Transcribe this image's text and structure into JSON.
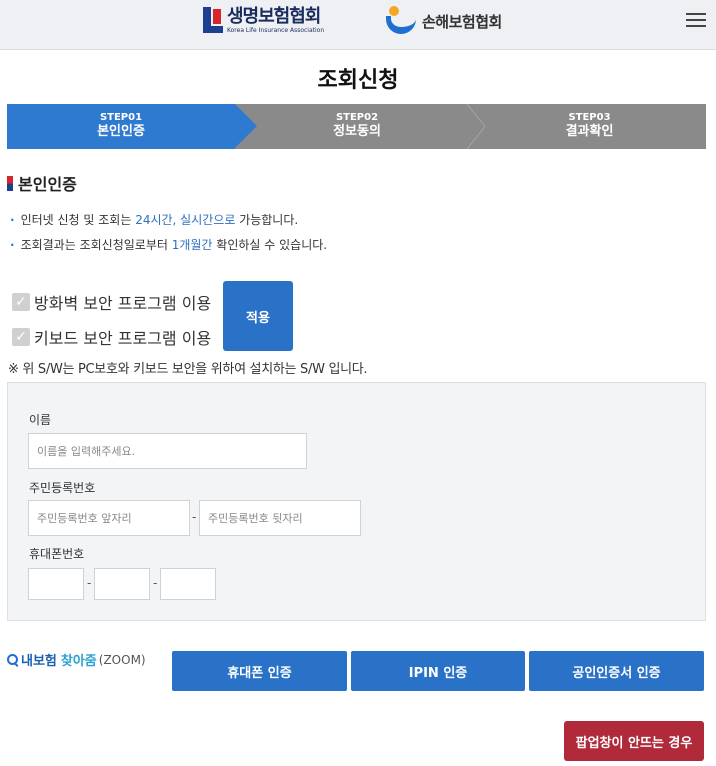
{
  "header": {
    "logo_life": "생명보험협회",
    "logo_life_sub": "Korea Life Insurance Association",
    "logo_nonlife": "손해보험협회"
  },
  "page_title": "조회신청",
  "steps": [
    {
      "num": "STEP01",
      "name": "본인인증",
      "active": true
    },
    {
      "num": "STEP02",
      "name": "정보동의",
      "active": false
    },
    {
      "num": "STEP03",
      "name": "결과확인",
      "active": false
    }
  ],
  "section_title": "본인인증",
  "notes": [
    {
      "pre": "인터넷 신청 및 조회는 ",
      "hl": "24시간, 실시간으로",
      "post": " 가능합니다."
    },
    {
      "pre": "조회결과는 조회신청일로부터 ",
      "hl": "1개월간",
      "post": " 확인하실 수 있습니다."
    }
  ],
  "security": {
    "firewall_label": "방화벽 보안 프로그램 이용",
    "keyboard_label": "키보드 보안 프로그램 이용",
    "apply_label": "적용",
    "sw_note": "※ 위 S/W는 PC보호와 키보드 보안을 위하여 설치하는 S/W 입니다."
  },
  "form": {
    "name_label": "이름",
    "name_placeholder": "이름을 입력해주세요.",
    "rrn_label": "주민등록번호",
    "rrn_front_placeholder": "주민등록번호 앞자리",
    "rrn_back_placeholder": "주민등록번호 뒷자리",
    "phone_label": "휴대폰번호",
    "dash": "-"
  },
  "zoom": {
    "part1": "내보험",
    "part2": "찾아줌",
    "part3": "(ZOOM)"
  },
  "auth_buttons": {
    "phone": "휴대폰 인증",
    "ipin": "IPIN 인증",
    "cert": "공인인증서 인증"
  },
  "popup_button": "팝업창이 안뜨는 경우",
  "colors": {
    "primary": "#2a72c8",
    "step_active": "#2e7ad1",
    "step_inactive": "#8a8a8a",
    "popup_button": "#b02a3a"
  }
}
